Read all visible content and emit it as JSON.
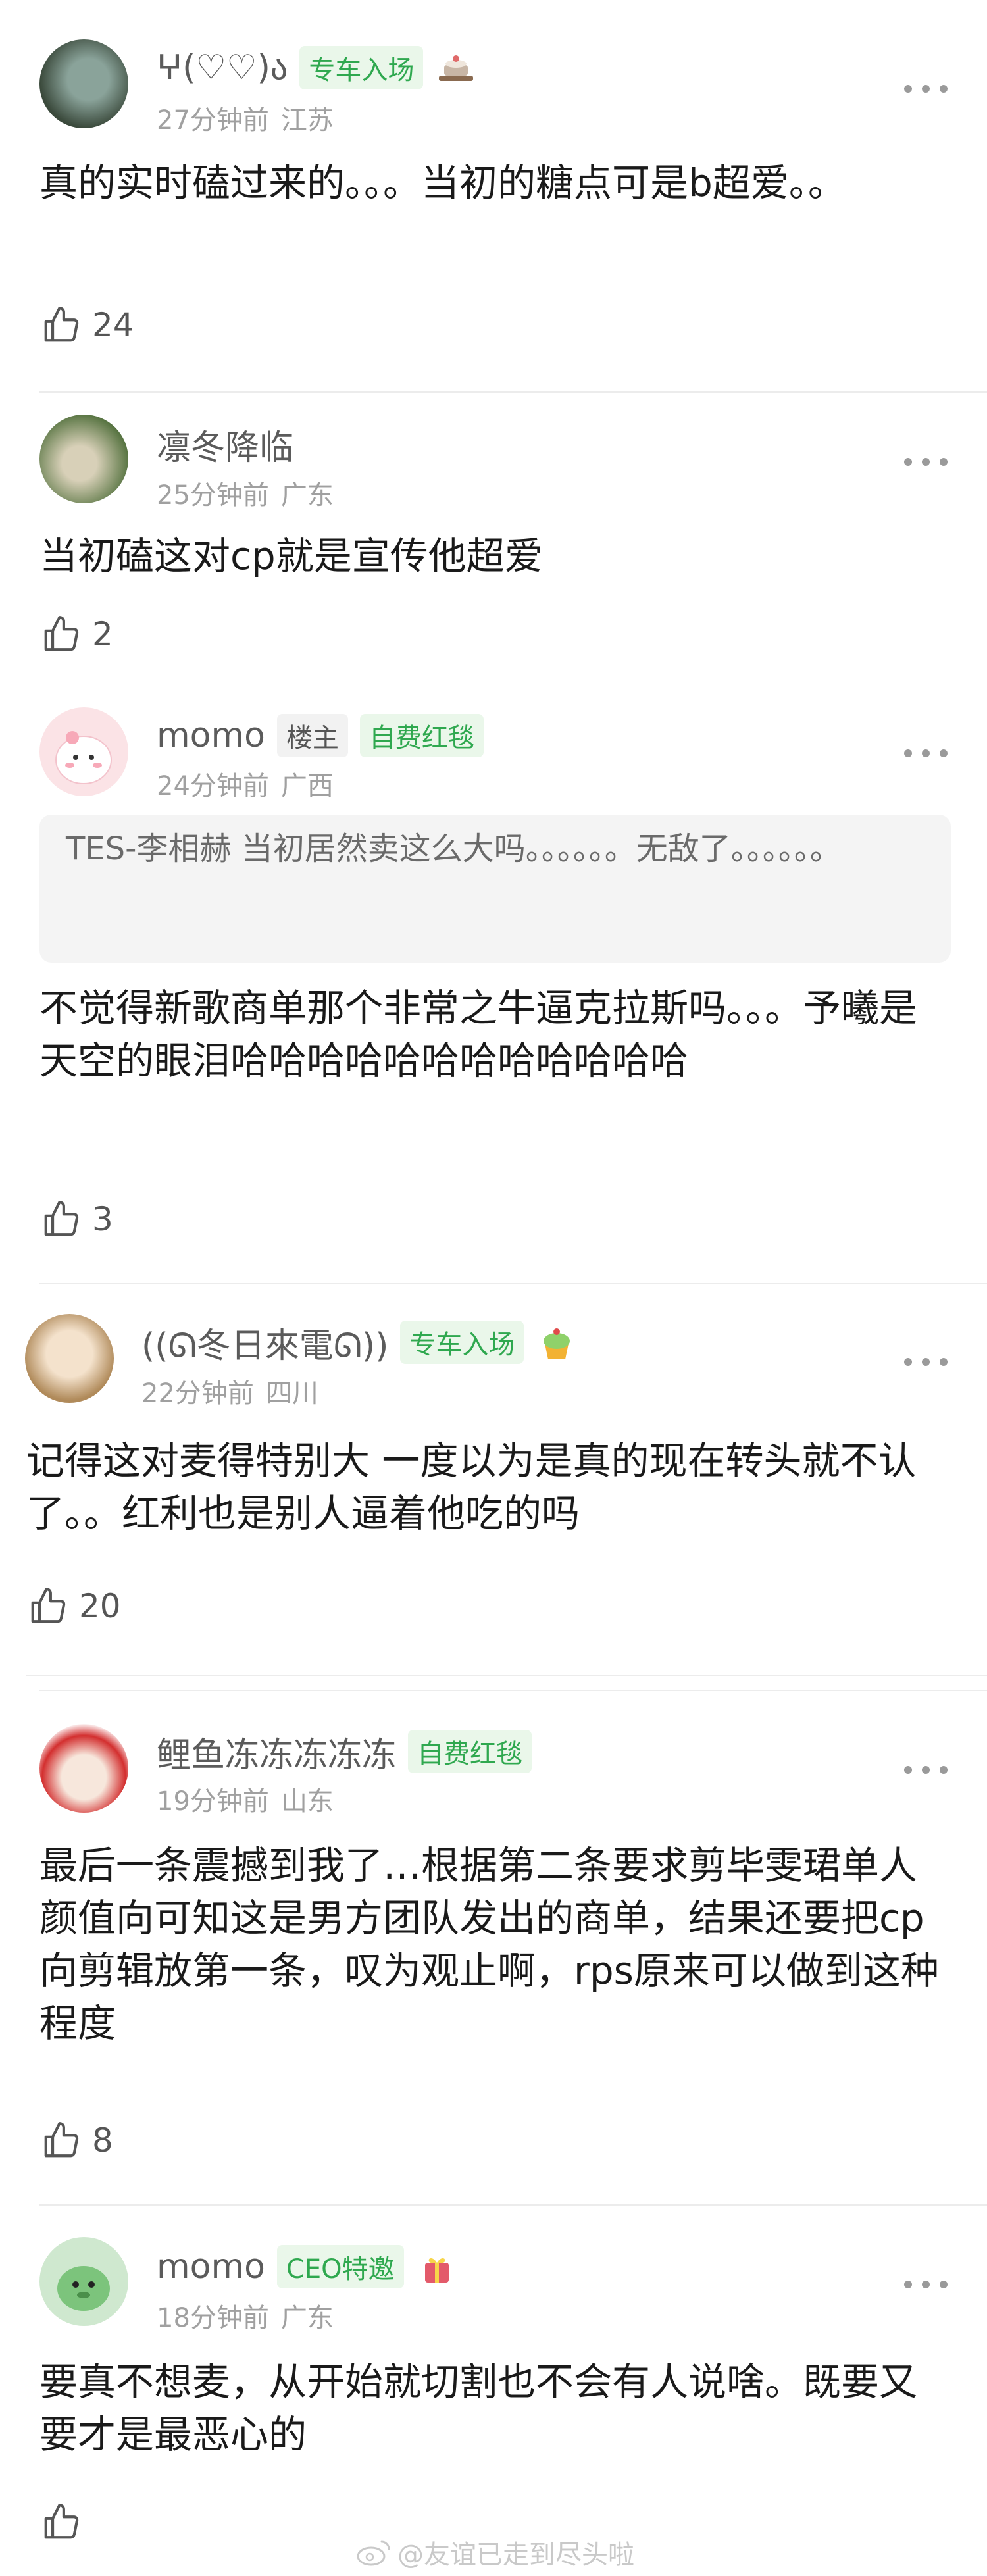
{
  "comments": [
    {
      "name": "ⵖ(♡♡)ა",
      "badge": "专车入场",
      "time": "27分钟前",
      "location": "江苏",
      "text": "真的实时磕过来的。。。当初的糖点可是b超爱。。",
      "likes": "24",
      "avatar_colors": [
        "#3b4a3c",
        "#8aa39a"
      ],
      "deco": "cake-stand-icon"
    },
    {
      "name": "凛冬降临",
      "time": "25分钟前",
      "location": "广东",
      "text": "当初磕这对cp就是宣传他超爱",
      "likes": "2",
      "avatar_colors": [
        "#4f6e3a",
        "#d8d0b8"
      ]
    },
    {
      "name": "momo",
      "tag": "楼主",
      "badge": "自费红毯",
      "time": "24分钟前",
      "location": "广西",
      "quote": "TES-李相赫 当初居然卖这么大吗。。。。。。无敌了。。。。。。",
      "text": "不觉得新歌商单那个非常之牛逼克拉斯吗。。。予曦是天空的眼泪哈哈哈哈哈哈哈哈哈哈哈哈",
      "likes": "3",
      "avatar_colors": [
        "#fbe3e6",
        "#ffffff"
      ]
    },
    {
      "name": "((ᘏ冬日來電ᘏ))",
      "badge": "专车入场",
      "time": "22分钟前",
      "location": "四川",
      "text": "记得这对麦得特别大 一度以为是真的现在转头就不认了。。红利也是别人逼着他吃的吗",
      "likes": "20",
      "avatar_colors": [
        "#e8dcc8",
        "#b08a5a"
      ],
      "deco": "cupcake-icon"
    },
    {
      "name": "鲤鱼冻冻冻冻冻",
      "badge": "自费红毯",
      "time": "19分钟前",
      "location": "山东",
      "text": "最后一条震撼到我了…根据第二条要求剪毕雯珺单人颜值向可知这是男方团队发出的商单，结果还要把cp向剪辑放第一条，叹为观止啊，rps原来可以做到这种程度",
      "likes": "8",
      "avatar_colors": [
        "#d32f2f",
        "#f7e7dc"
      ]
    },
    {
      "name": "momo",
      "badge": "CEO特邀",
      "time": "18分钟前",
      "location": "广东",
      "text": "要真不想麦，从开始就切割也不会有人说啥。既要又要才是最恶心的",
      "likes": "",
      "avatar_colors": [
        "#cfe8cf",
        "#5aa05a"
      ],
      "deco": "gift-icon"
    }
  ],
  "watermark": "@友谊已走到尽头啦",
  "colors": {
    "badge_green": "#2fa84f",
    "badge_bg": "#eaf7ea",
    "meta_gray": "#a0a0a0"
  }
}
